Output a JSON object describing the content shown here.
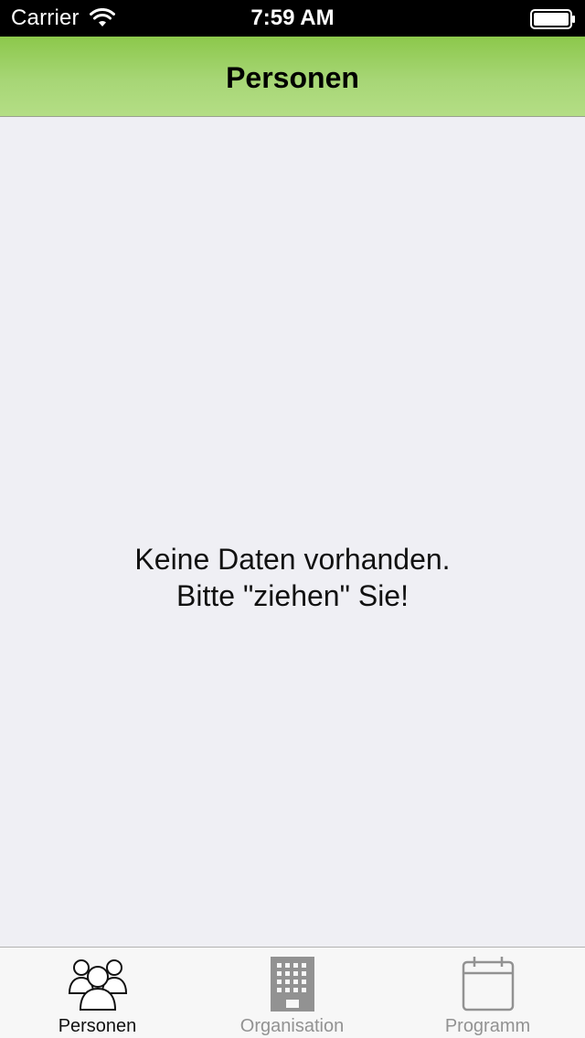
{
  "status_bar": {
    "carrier": "Carrier",
    "time": "7:59 AM",
    "wifi_icon": "wifi-icon",
    "battery_icon": "battery-icon"
  },
  "nav_bar": {
    "title": "Personen",
    "color": "#9bd163"
  },
  "content": {
    "empty_line_1": "Keine Daten vorhanden.",
    "empty_line_2": "Bitte \"ziehen\" Sie!"
  },
  "tab_bar": {
    "active_color": "#111111",
    "inactive_color": "#929292",
    "tabs": [
      {
        "label": "Personen",
        "icon": "people-icon",
        "selected": true
      },
      {
        "label": "Organisation",
        "icon": "building-icon",
        "selected": false
      },
      {
        "label": "Programm",
        "icon": "calendar-icon",
        "selected": false
      }
    ]
  }
}
